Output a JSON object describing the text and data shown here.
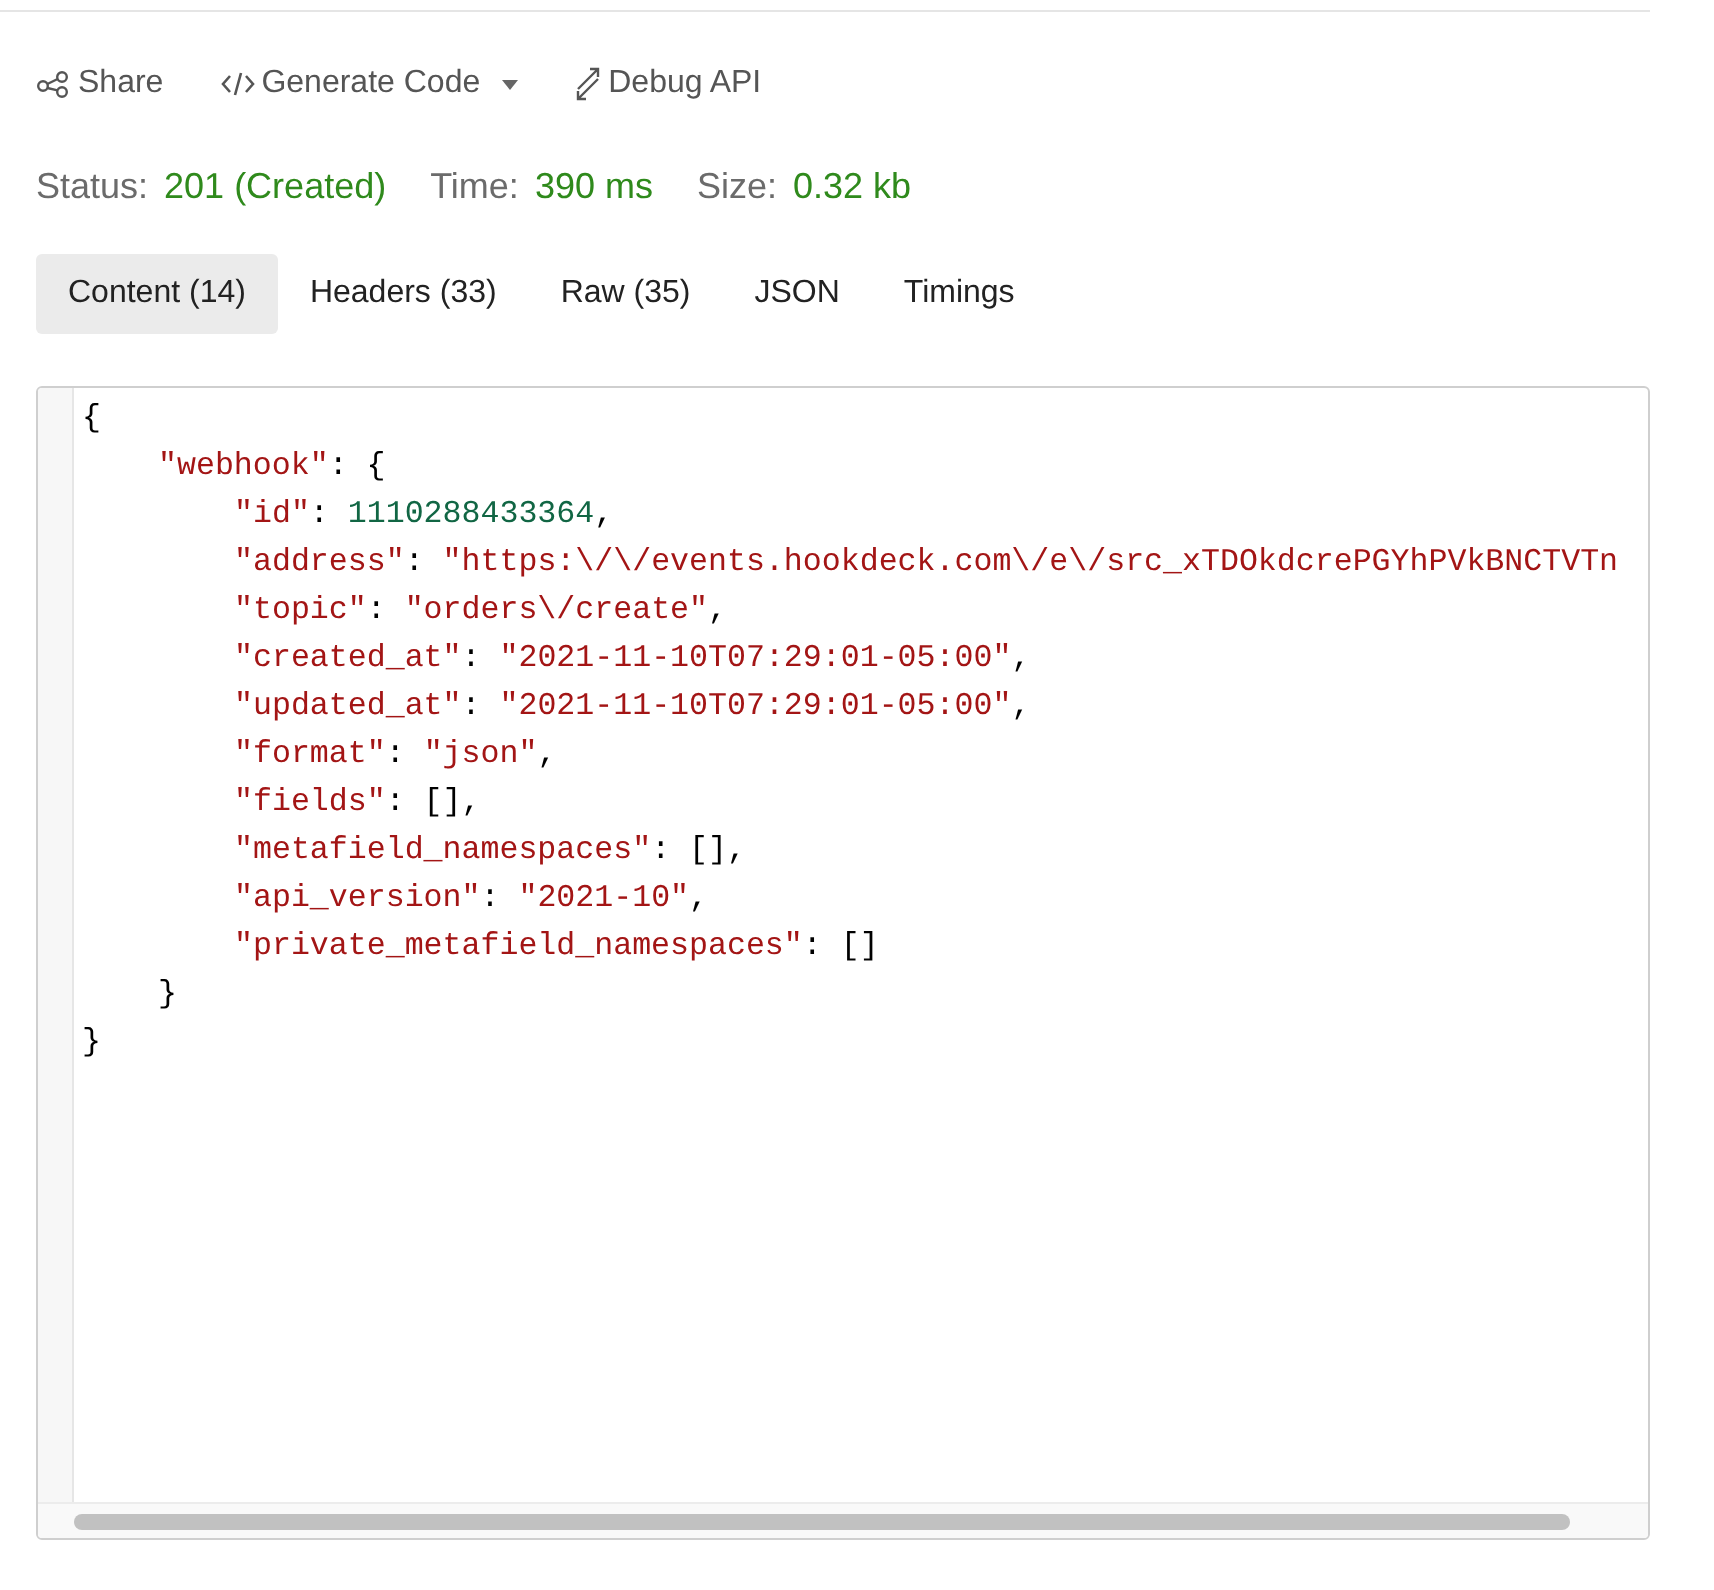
{
  "toolbar": [
    {
      "kind": "share",
      "label": "Share"
    },
    {
      "kind": "code",
      "label": "Generate Code",
      "dropdown": true
    },
    {
      "kind": "debug",
      "label": "Debug API"
    }
  ],
  "status": [
    {
      "label": "Status:",
      "value": "201 (Created)"
    },
    {
      "label": "Time:",
      "value": "390 ms"
    },
    {
      "label": "Size:",
      "value": "0.32 kb"
    }
  ],
  "tabs": [
    {
      "label": "Content (14)",
      "selected": true
    },
    {
      "label": "Headers (33)",
      "selected": false
    },
    {
      "label": "Raw (35)",
      "selected": false
    },
    {
      "label": "JSON",
      "selected": false
    },
    {
      "label": "Timings",
      "selected": false
    }
  ],
  "code": [
    {
      "tokens": [
        {
          "kind": "punct",
          "text": "{"
        }
      ],
      "children": [
        {
          "tokens": [
            {
              "kind": "key",
              "text": "\"webhook\""
            },
            {
              "kind": "punct",
              "text": ": {"
            }
          ],
          "children": [
            {
              "tokens": [
                {
                  "kind": "key",
                  "text": "\"id\""
                },
                {
                  "kind": "punct",
                  "text": ": "
                },
                {
                  "kind": "number",
                  "text": "1110288433364"
                },
                {
                  "kind": "punct",
                  "text": ","
                }
              ]
            },
            {
              "tokens": [
                {
                  "kind": "key",
                  "text": "\"address\""
                },
                {
                  "kind": "punct",
                  "text": ": "
                },
                {
                  "kind": "string",
                  "text": "\"https:\\/\\/events.hookdeck.com\\/e\\/src_xTDOkdcrePGYhPVkBNCTVTn"
                }
              ]
            },
            {
              "tokens": [
                {
                  "kind": "key",
                  "text": "\"topic\""
                },
                {
                  "kind": "punct",
                  "text": ": "
                },
                {
                  "kind": "string",
                  "text": "\"orders\\/create\""
                },
                {
                  "kind": "punct",
                  "text": ","
                }
              ]
            },
            {
              "tokens": [
                {
                  "kind": "key",
                  "text": "\"created_at\""
                },
                {
                  "kind": "punct",
                  "text": ": "
                },
                {
                  "kind": "string",
                  "text": "\"2021-11-10T07:29:01-05:00\""
                },
                {
                  "kind": "punct",
                  "text": ","
                }
              ]
            },
            {
              "tokens": [
                {
                  "kind": "key",
                  "text": "\"updated_at\""
                },
                {
                  "kind": "punct",
                  "text": ": "
                },
                {
                  "kind": "string",
                  "text": "\"2021-11-10T07:29:01-05:00\""
                },
                {
                  "kind": "punct",
                  "text": ","
                }
              ]
            },
            {
              "tokens": [
                {
                  "kind": "key",
                  "text": "\"format\""
                },
                {
                  "kind": "punct",
                  "text": ": "
                },
                {
                  "kind": "string",
                  "text": "\"json\""
                },
                {
                  "kind": "punct",
                  "text": ","
                }
              ]
            },
            {
              "tokens": [
                {
                  "kind": "key",
                  "text": "\"fields\""
                },
                {
                  "kind": "punct",
                  "text": ": [],"
                }
              ]
            },
            {
              "tokens": [
                {
                  "kind": "key",
                  "text": "\"metafield_namespaces\""
                },
                {
                  "kind": "punct",
                  "text": ": [],"
                }
              ]
            },
            {
              "tokens": [
                {
                  "kind": "key",
                  "text": "\"api_version\""
                },
                {
                  "kind": "punct",
                  "text": ": "
                },
                {
                  "kind": "string",
                  "text": "\"2021-10\""
                },
                {
                  "kind": "punct",
                  "text": ","
                }
              ]
            },
            {
              "tokens": [
                {
                  "kind": "key",
                  "text": "\"private_metafield_namespaces\""
                },
                {
                  "kind": "punct",
                  "text": ": []"
                }
              ]
            }
          ]
        },
        {
          "tokens": [
            {
              "kind": "punct",
              "text": "}"
            }
          ]
        }
      ]
    },
    {
      "tokens": [
        {
          "kind": "punct",
          "text": "}"
        }
      ]
    }
  ]
}
